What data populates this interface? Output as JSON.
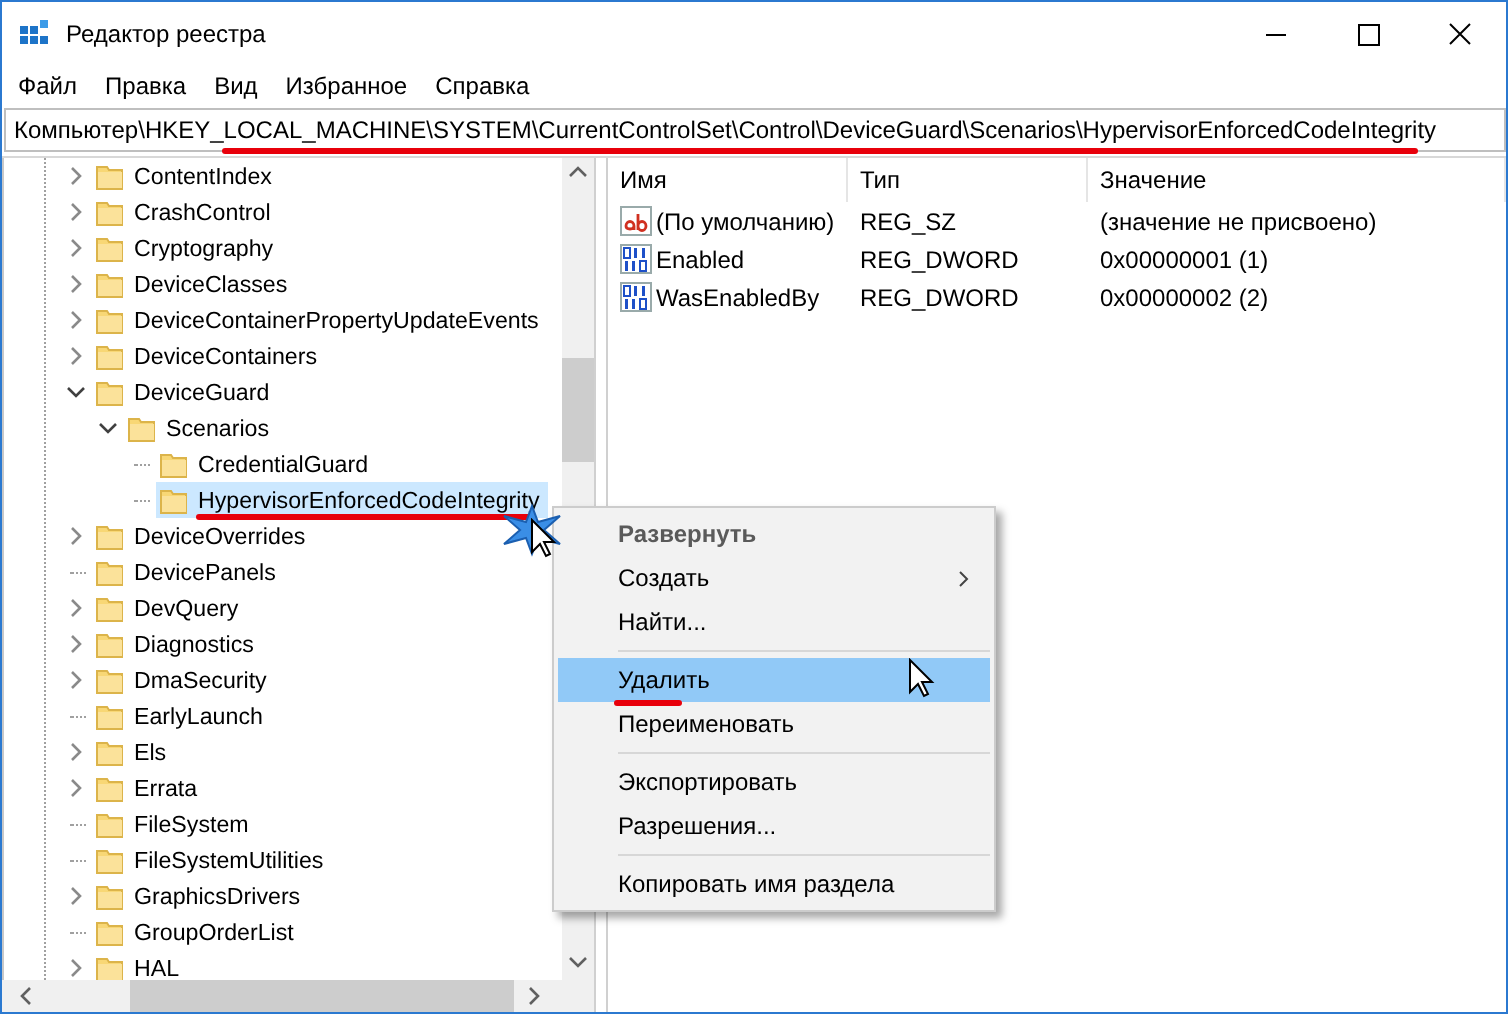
{
  "window": {
    "title": "Редактор реестра"
  },
  "menu": [
    "Файл",
    "Правка",
    "Вид",
    "Избранное",
    "Справка"
  ],
  "address_bar": {
    "value": "Компьютер\\HKEY_LOCAL_MACHINE\\SYSTEM\\CurrentControlSet\\Control\\DeviceGuard\\Scenarios\\HypervisorEnforcedCodeIntegrity",
    "underlined": true
  },
  "tree": [
    {
      "name": "ContentIndex",
      "kind": "collapsed",
      "selected": false,
      "underlined": false
    },
    {
      "name": "CrashControl",
      "kind": "collapsed",
      "selected": false,
      "underlined": false
    },
    {
      "name": "Cryptography",
      "kind": "collapsed",
      "selected": false,
      "underlined": false
    },
    {
      "name": "DeviceClasses",
      "kind": "collapsed",
      "selected": false,
      "underlined": false
    },
    {
      "name": "DeviceContainerPropertyUpdateEvents",
      "kind": "collapsed",
      "selected": false,
      "underlined": false
    },
    {
      "name": "DeviceContainers",
      "kind": "collapsed",
      "selected": false,
      "underlined": false
    },
    {
      "name": "DeviceGuard",
      "kind": "expanded",
      "selected": false,
      "underlined": false,
      "children": [
        {
          "name": "Scenarios",
          "kind": "expanded",
          "selected": false,
          "underlined": false,
          "children": [
            {
              "name": "CredentialGuard",
              "kind": "leaf",
              "selected": false,
              "underlined": false
            },
            {
              "name": "HypervisorEnforcedCodeIntegrity",
              "kind": "leaf",
              "selected": true,
              "underlined": true
            }
          ]
        }
      ]
    },
    {
      "name": "DeviceOverrides",
      "kind": "collapsed",
      "selected": false,
      "underlined": false
    },
    {
      "name": "DevicePanels",
      "kind": "leaf",
      "selected": false,
      "underlined": false
    },
    {
      "name": "DevQuery",
      "kind": "collapsed",
      "selected": false,
      "underlined": false
    },
    {
      "name": "Diagnostics",
      "kind": "collapsed",
      "selected": false,
      "underlined": false
    },
    {
      "name": "DmaSecurity",
      "kind": "collapsed",
      "selected": false,
      "underlined": false
    },
    {
      "name": "EarlyLaunch",
      "kind": "leaf",
      "selected": false,
      "underlined": false
    },
    {
      "name": "Els",
      "kind": "collapsed",
      "selected": false,
      "underlined": false
    },
    {
      "name": "Errata",
      "kind": "collapsed",
      "selected": false,
      "underlined": false
    },
    {
      "name": "FileSystem",
      "kind": "leaf",
      "selected": false,
      "underlined": false
    },
    {
      "name": "FileSystemUtilities",
      "kind": "leaf",
      "selected": false,
      "underlined": false
    },
    {
      "name": "GraphicsDrivers",
      "kind": "collapsed",
      "selected": false,
      "underlined": false
    },
    {
      "name": "GroupOrderList",
      "kind": "leaf",
      "selected": false,
      "underlined": false
    },
    {
      "name": "HAL",
      "kind": "collapsed",
      "selected": false,
      "underlined": false
    }
  ],
  "values": {
    "columns": [
      "Имя",
      "Тип",
      "Значение"
    ],
    "rows": [
      {
        "kind": "string",
        "name": "(По умолчанию)",
        "type": "REG_SZ",
        "data": "(значение не присвоено)"
      },
      {
        "kind": "dword",
        "name": "Enabled",
        "type": "REG_DWORD",
        "data": "0x00000001 (1)"
      },
      {
        "kind": "dword",
        "name": "WasEnabledBy",
        "type": "REG_DWORD",
        "data": "0x00000002 (2)"
      }
    ]
  },
  "context_menu": [
    {
      "kind": "item",
      "label": "Развернуть",
      "default": true,
      "submenu": false,
      "selected": false,
      "underlined": false
    },
    {
      "kind": "item",
      "label": "Создать",
      "default": false,
      "submenu": true,
      "selected": false,
      "underlined": false
    },
    {
      "kind": "item",
      "label": "Найти...",
      "default": false,
      "submenu": false,
      "selected": false,
      "underlined": false
    },
    {
      "kind": "separator"
    },
    {
      "kind": "item",
      "label": "Удалить",
      "default": false,
      "submenu": false,
      "selected": true,
      "underlined": true
    },
    {
      "kind": "item",
      "label": "Переименовать",
      "default": false,
      "submenu": false,
      "selected": false,
      "underlined": false
    },
    {
      "kind": "separator"
    },
    {
      "kind": "item",
      "label": "Экспортировать",
      "default": false,
      "submenu": false,
      "selected": false,
      "underlined": false
    },
    {
      "kind": "item",
      "label": "Разрешения...",
      "default": false,
      "submenu": false,
      "selected": false,
      "underlined": false
    },
    {
      "kind": "separator"
    },
    {
      "kind": "item",
      "label": "Копировать имя раздела",
      "default": false,
      "submenu": false,
      "selected": false,
      "underlined": false
    }
  ]
}
